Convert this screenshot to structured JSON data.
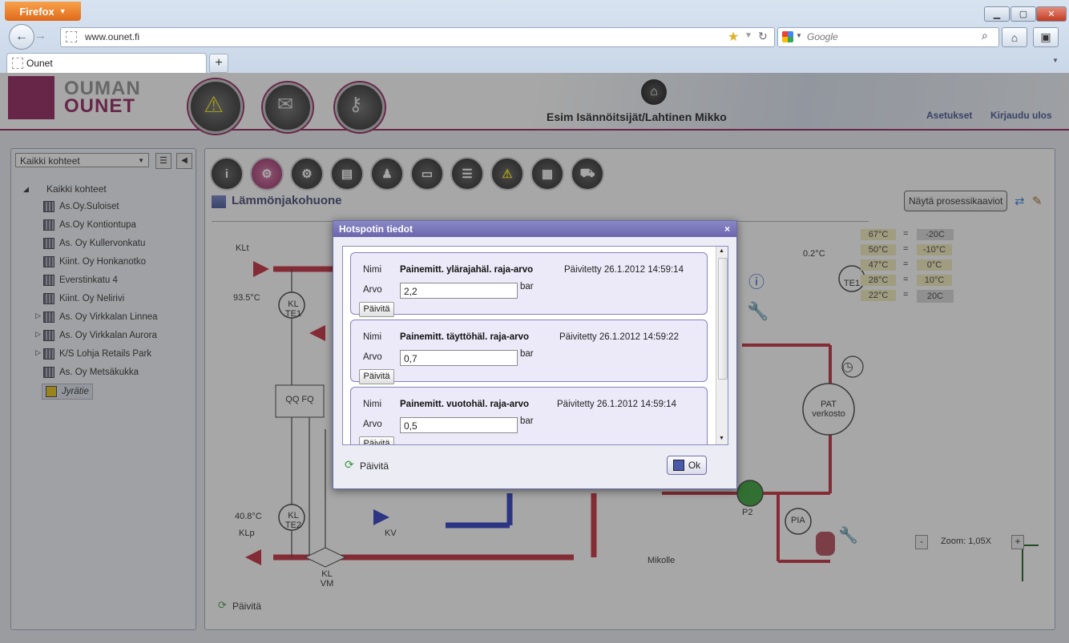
{
  "browser": {
    "menu_label": "Firefox",
    "url": "www.ounet.fi",
    "search_placeholder": "Google",
    "tab_title": "Ounet"
  },
  "header": {
    "brand_line1": "OUMAN",
    "brand_line2": "OUNET",
    "user_name": "Esim Isännöitsijät/Lahtinen Mikko",
    "settings_label": "Asetukset",
    "logout_label": "Kirjaudu ulos"
  },
  "sidebar": {
    "select_value": "Kaikki kohteet",
    "root_label": "Kaikki kohteet",
    "items": [
      {
        "label": "As.Oy.Suloiset"
      },
      {
        "label": "As.Oy Kontiontupa"
      },
      {
        "label": "As. Oy Kullervonkatu"
      },
      {
        "label": "Kiint. Oy Honkanotko"
      },
      {
        "label": "Everstinkatu 4"
      },
      {
        "label": "Kiint. Oy Nelirivi"
      },
      {
        "label": "As. Oy Virkkalan Linnea"
      },
      {
        "label": "As. Oy Virkkalan Aurora"
      },
      {
        "label": "K/S Lohja Retails Park"
      },
      {
        "label": "As. Oy Metsäkukka"
      },
      {
        "label": "Jyrätie"
      }
    ]
  },
  "main": {
    "page_title": "Lämmönjakohuone",
    "process_button": "Näytä prosessikaaviot",
    "refresh_label": "Päivitä",
    "zoom_label": "Zoom: 1,05X",
    "temp_table": [
      {
        "outdoor": "67°C",
        "value": "-20C"
      },
      {
        "outdoor": "50°C",
        "value": "-10°C"
      },
      {
        "outdoor": "47°C",
        "value": "0°C"
      },
      {
        "outdoor": "28°C",
        "value": "10°C"
      },
      {
        "outdoor": "22°C",
        "value": "20C"
      }
    ],
    "diagram": {
      "klt": "KLt",
      "klt_temp": "93.5°C",
      "kl_te1": "KL TE1",
      "qq_fq": "QQ FQ",
      "kl_te2": "KL TE2",
      "klp_temp": "40.8°C",
      "klp": "KLp",
      "kl_vm": "KL VM",
      "kv": "KV",
      "te1_temp": "0.2°C",
      "te1": "TE1",
      "pat": "PAT verkosto",
      "p2": "P2",
      "pia": "PIA",
      "mikolle": "Mikolle"
    }
  },
  "dialog": {
    "title": "Hotspotin tiedot",
    "name_label": "Nimi",
    "value_label": "Arvo",
    "unit": "bar",
    "update_button": "Päivitä",
    "cards": [
      {
        "name": "Painemitt. ylärajahäl. raja-arvo",
        "updated": "Päivitetty 26.1.2012 14:59:14",
        "value": "2,2"
      },
      {
        "name": "Painemitt. täyttöhäl. raja-arvo",
        "updated": "Päivitetty 26.1.2012 14:59:22",
        "value": "0,7"
      },
      {
        "name": "Painemitt. vuotohäl. raja-arvo",
        "updated": "Päivitetty 26.1.2012 14:59:14",
        "value": "0,5"
      }
    ],
    "footer_refresh": "Päivitä",
    "ok_label": "Ok"
  }
}
